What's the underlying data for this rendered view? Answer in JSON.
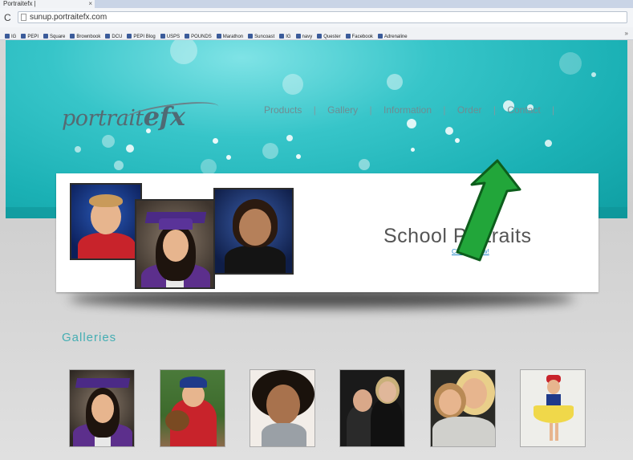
{
  "browser": {
    "tab_title": "Portraitefx |",
    "tab_close": "×",
    "reload_icon": "C",
    "url": "sunup.portraitefx.com",
    "bookmarks": [
      "IG",
      "PEPI",
      "Square",
      "Brownbook",
      "DCU",
      "PEPI Blog",
      "USPS",
      "POUNDS",
      "Marathon",
      "Suncoast",
      "IG",
      "navy",
      "Quester",
      "Facebook",
      "Adrenaline"
    ],
    "more_icon": "»"
  },
  "site": {
    "logo_main": "portrait",
    "logo_efx": "efx",
    "nav": [
      "Products",
      "Gallery",
      "Information",
      "Order",
      "Contact"
    ],
    "nav_separator": "|"
  },
  "banner": {
    "title": "School Portraits",
    "link": "Click to view!"
  },
  "galleries": {
    "title": "Galleries",
    "thumbs": [
      "graduate-portrait",
      "baseball-player",
      "girl-portrait",
      "couple-portrait",
      "mother-daughter",
      "dancer"
    ]
  },
  "colors": {
    "hero_teal": "#1bb1b5",
    "accent": "#45aeb3",
    "arrow_green": "#22a63a"
  }
}
